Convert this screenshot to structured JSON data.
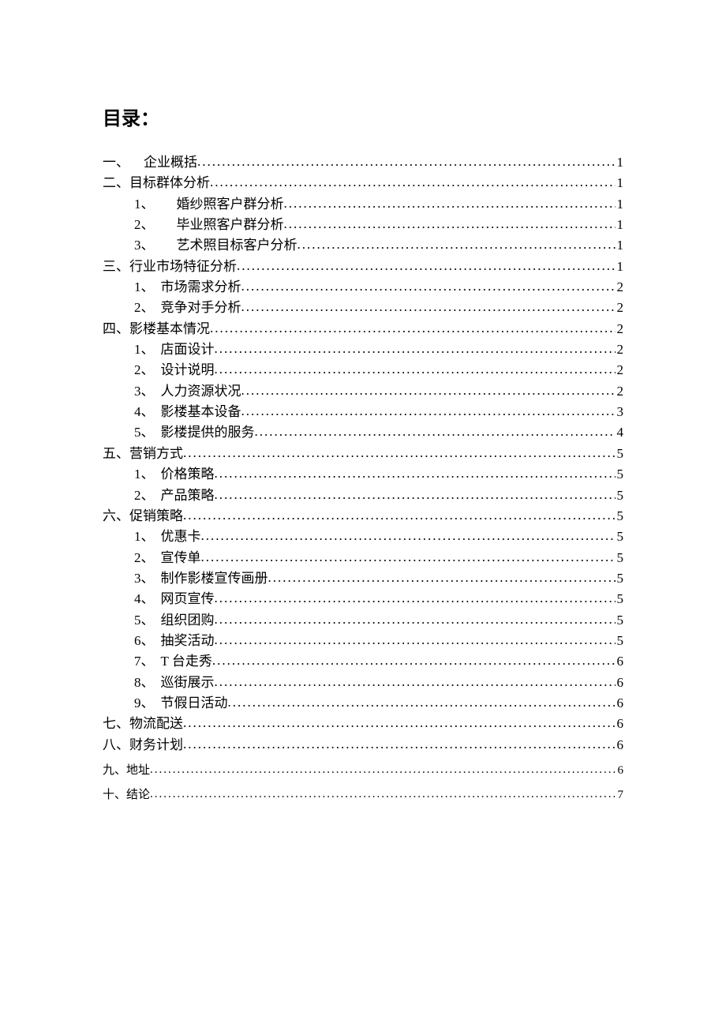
{
  "title": "目录：",
  "entries": [
    {
      "level": 1,
      "prefix": "一、",
      "gapAfterPrefix": true,
      "text": "企业概括",
      "page": "1"
    },
    {
      "level": 1,
      "prefix": "二、",
      "text": "目标群体分析",
      "page": "1"
    },
    {
      "level": 2,
      "prefix": "1、",
      "gapAfterPrefix": true,
      "text": "婚纱照客户群分析",
      "page": "1"
    },
    {
      "level": 2,
      "prefix": "2、",
      "gapAfterPrefix": true,
      "text": "毕业照客户群分析",
      "page": "1"
    },
    {
      "level": 2,
      "prefix": "3、",
      "gapAfterPrefix": true,
      "text": "艺术照目标客户分析",
      "page": "1"
    },
    {
      "level": 1,
      "prefix": "三、",
      "text": "行业市场特征分析",
      "page": "1"
    },
    {
      "level": 2,
      "prefix": "1、",
      "text": "市场需求分析",
      "page": "2"
    },
    {
      "level": 2,
      "prefix": "2、",
      "text": "竞争对手分析",
      "page": "2"
    },
    {
      "level": 1,
      "prefix": "四、",
      "text": "影楼基本情况",
      "page": "2"
    },
    {
      "level": 2,
      "prefix": "1、",
      "text": "店面设计",
      "page": "2"
    },
    {
      "level": 2,
      "prefix": "2、",
      "text": "设计说明",
      "page": "2"
    },
    {
      "level": 2,
      "prefix": "3、",
      "text": "人力资源状况",
      "page": "2"
    },
    {
      "level": 2,
      "prefix": "4、",
      "text": "影楼基本设备",
      "page": "3"
    },
    {
      "level": 2,
      "prefix": "5、",
      "text": "影楼提供的服务",
      "page": "4"
    },
    {
      "level": 1,
      "prefix": "五、",
      "text": "营销方式",
      "page": "5"
    },
    {
      "level": 2,
      "prefix": "1、",
      "text": "价格策略",
      "page": "5"
    },
    {
      "level": 2,
      "prefix": "2、",
      "text": "产品策略",
      "page": "5"
    },
    {
      "level": 1,
      "prefix": "六、",
      "text": "促销策略",
      "page": "5"
    },
    {
      "level": 2,
      "prefix": "1、",
      "text": "优惠卡",
      "page": "5"
    },
    {
      "level": 2,
      "prefix": "2、",
      "text": "宣传单",
      "page": "5"
    },
    {
      "level": 2,
      "prefix": "3、",
      "text": "制作影楼宣传画册",
      "page": "5"
    },
    {
      "level": 2,
      "prefix": "4、",
      "text": "网页宣传",
      "page": "5"
    },
    {
      "level": 2,
      "prefix": "5、",
      "text": "组织团购",
      "page": "5"
    },
    {
      "level": 2,
      "prefix": "6、",
      "text": "抽奖活动",
      "page": "5"
    },
    {
      "level": 2,
      "prefix": "7、",
      "text": "T 台走秀",
      "page": "6"
    },
    {
      "level": 2,
      "prefix": "8、",
      "text": "巡街展示",
      "page": "6"
    },
    {
      "level": 2,
      "prefix": "9、",
      "text": "节假日活动",
      "page": "6"
    },
    {
      "level": 1,
      "prefix": "七、",
      "text": "物流配送",
      "page": "6"
    },
    {
      "level": 1,
      "prefix": "八、",
      "text": "财务计划",
      "page": "6"
    },
    {
      "level": 1,
      "prefix": "九、",
      "text": "地址",
      "page": "6",
      "small": true
    },
    {
      "level": 1,
      "prefix": "十、",
      "text": "结论",
      "page": "7",
      "small": true
    }
  ]
}
